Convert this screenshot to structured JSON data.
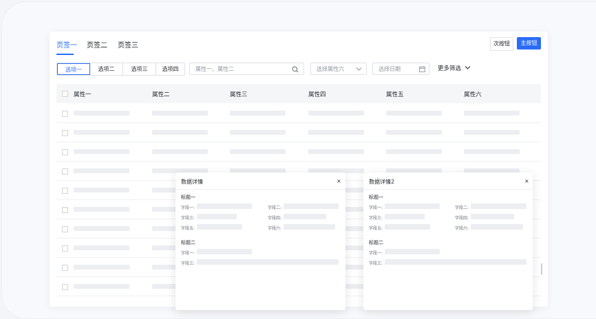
{
  "tabs": [
    {
      "label": "页签一",
      "active": true
    },
    {
      "label": "页签二",
      "active": false
    },
    {
      "label": "页签三",
      "active": false
    }
  ],
  "toolbar": {
    "secondary_label": "次按钮",
    "primary_label": "主按钮"
  },
  "filters": {
    "segments": [
      {
        "label": "选项一",
        "active": true
      },
      {
        "label": "选项二",
        "active": false
      },
      {
        "label": "选项三",
        "active": false
      },
      {
        "label": "选项四",
        "active": false
      }
    ],
    "search_placeholder": "属性一、属性二",
    "select_placeholder": "选择属性六",
    "date_placeholder": "选择日期",
    "more_label": "更多筛选"
  },
  "table": {
    "columns": [
      "属性一",
      "属性二",
      "属性三",
      "属性四",
      "属性五",
      "属性六"
    ]
  },
  "panels": [
    {
      "title": "数据详情",
      "close": "×",
      "sections": [
        {
          "title": "标题一",
          "fields": [
            "字段一:",
            "字段二:",
            "字段三:",
            "字段四:",
            "字段五:",
            "字段六:"
          ]
        },
        {
          "title": "标题二",
          "fields": [
            "字段一:",
            "字段三:"
          ]
        }
      ]
    },
    {
      "title": "数据详情2",
      "close": "×",
      "sections": [
        {
          "title": "标题一",
          "fields": [
            "字段一:",
            "字段二:",
            "字段三:",
            "字段四:",
            "字段五:",
            "字段六:"
          ]
        },
        {
          "title": "标题二",
          "fields": [
            "字段一:",
            "字段三:"
          ]
        }
      ]
    }
  ],
  "colors": {
    "accent": "#2a6cf6",
    "skeleton": "#eceef1",
    "header_bg": "#f5f6f7"
  }
}
